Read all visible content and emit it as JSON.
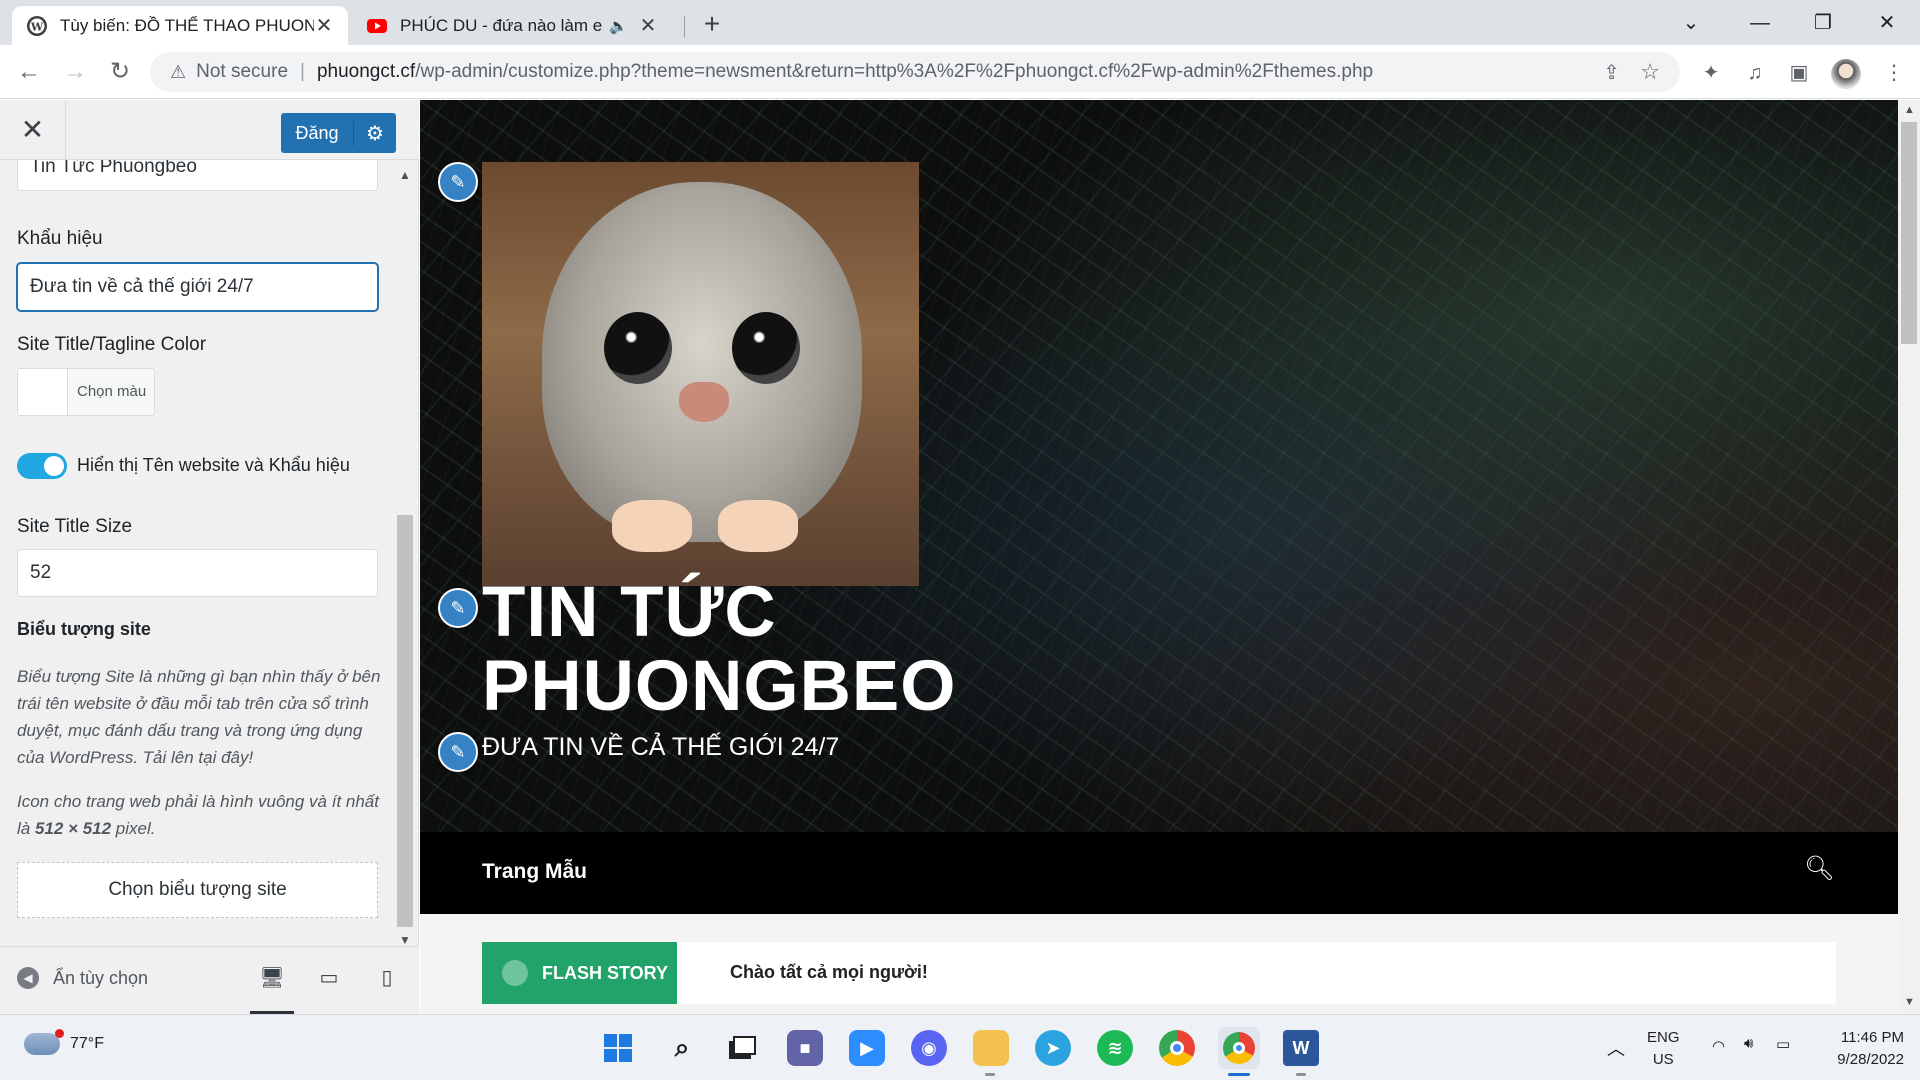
{
  "browser": {
    "tabs": [
      {
        "title": "Tùy biến: ĐỒ THỂ THAO PHUONG",
        "icon": "wordpress-icon",
        "active": true
      },
      {
        "title": "PHÚC DU - đứa nào làm em",
        "icon": "youtube-icon",
        "active": false,
        "audio": true
      }
    ],
    "new_tab": "+",
    "address": {
      "security": "Not secure",
      "host": "phuongct.cf",
      "path": "/wp-admin/customize.php?theme=newsment&return=http%3A%2F%2Fphuongct.cf%2Fwp-admin%2Fthemes.php"
    }
  },
  "customizer": {
    "publish_label": "Đăng",
    "site_title_value": "Tin Tức Phuongbeo",
    "tagline_label": "Khẩu hiệu",
    "tagline_value": "Đưa tin về cả thế giới 24/7",
    "color_label": "Site Title/Tagline Color",
    "color_button": "Chọn màu",
    "display_toggle_label": "Hiển thị Tên website và Khẩu hiệu",
    "display_toggle_on": true,
    "title_size_label": "Site Title Size",
    "title_size_value": "52",
    "site_icon_label": "Biểu tượng site",
    "site_icon_desc": "Biểu tượng Site là những gì bạn nhìn thấy ở bên trái tên website ở đầu mỗi tab trên cửa sổ trình duyệt, mục đánh dấu trang và trong ứng dụng của WordPress. Tải lên tại đây!",
    "site_icon_note_prefix": "Icon cho trang web phải là hình vuông và ít nhất là ",
    "site_icon_note_size": "512 × 512",
    "site_icon_note_suffix": " pixel.",
    "select_icon_button": "Chọn biểu tượng site",
    "hide_controls": "Ẩn tùy chọn",
    "devices": [
      "desktop",
      "tablet",
      "mobile"
    ],
    "active_device": "desktop"
  },
  "preview": {
    "site_title_line1": "TIN TỨC",
    "site_title_line2": "PHUONGBEO",
    "tagline": "ĐƯA TIN VỀ CẢ THẾ GIỚI 24/7",
    "menu_item": "Trang Mẫu",
    "flash_label": "FLASH STORY",
    "flash_text": "Chào tất cả mọi người!"
  },
  "taskbar": {
    "temperature": "77°F",
    "apps": [
      "start",
      "search",
      "task-view",
      "teams",
      "zoom",
      "discord",
      "file-explorer",
      "telegram",
      "spotify",
      "chrome",
      "chrome-profile",
      "word"
    ],
    "language": "ENG",
    "region": "US",
    "time": "11:46 PM",
    "date": "9/28/2022"
  }
}
